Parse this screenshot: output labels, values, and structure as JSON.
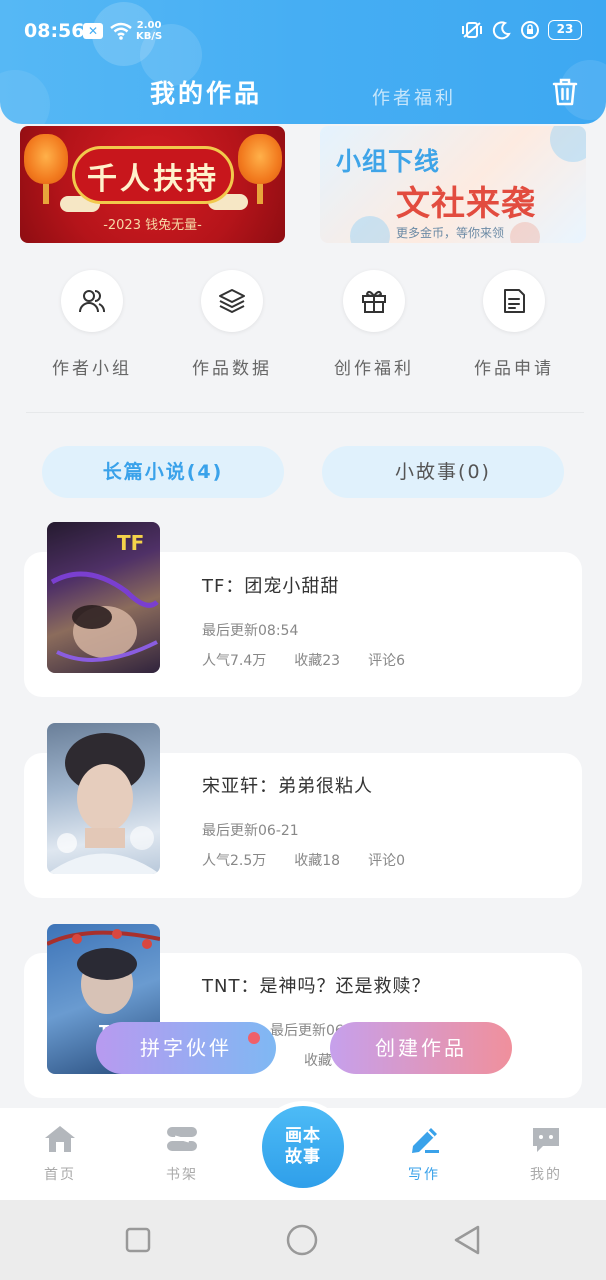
{
  "status_bar": {
    "time": "08:56",
    "notification_badge": "✕",
    "speed_value": "2.00",
    "speed_unit": "KB/S",
    "battery": "23"
  },
  "header": {
    "tab_active": "我的作品",
    "tab_inactive": "作者福利"
  },
  "banners": {
    "left": {
      "title": "千人扶持",
      "subtitle": "-2023 钱兔无量-"
    },
    "right": {
      "line1": "小组下线",
      "line2": "文社来袭",
      "line3": "更多金币，等你来领"
    }
  },
  "quick_menu": [
    {
      "label": "作者小组",
      "icon": "users-icon"
    },
    {
      "label": "作品数据",
      "icon": "layers-icon"
    },
    {
      "label": "创作福利",
      "icon": "gift-icon"
    },
    {
      "label": "作品申请",
      "icon": "document-icon"
    }
  ],
  "categories": {
    "active": "长篇小说(4)",
    "inactive": "小故事(0)"
  },
  "works": [
    {
      "title": "TF：团宠小甜甜",
      "updated": "最后更新08:54",
      "popularity": "人气7.4万",
      "favorites": "收藏23",
      "comments": "评论6"
    },
    {
      "title": "宋亚轩：弟弟很粘人",
      "updated": "最后更新06-21",
      "popularity": "人气2.5万",
      "favorites": "收藏18",
      "comments": "评论0"
    },
    {
      "title": "TNT：是神吗？还是救赎？",
      "updated": "最后更新06-15",
      "popularity": "",
      "favorites": "收藏",
      "comments": ""
    }
  ],
  "fab": {
    "left": "拼字伙伴",
    "right": "创建作品"
  },
  "bottom_nav": {
    "home": "首页",
    "bookshelf": "书架",
    "center_line1": "画本",
    "center_line2": "故事",
    "write": "写作",
    "mine": "我的"
  },
  "colors": {
    "accent": "#3aa2ea",
    "header": "#46aef3",
    "banner_red": "#c8161c"
  }
}
